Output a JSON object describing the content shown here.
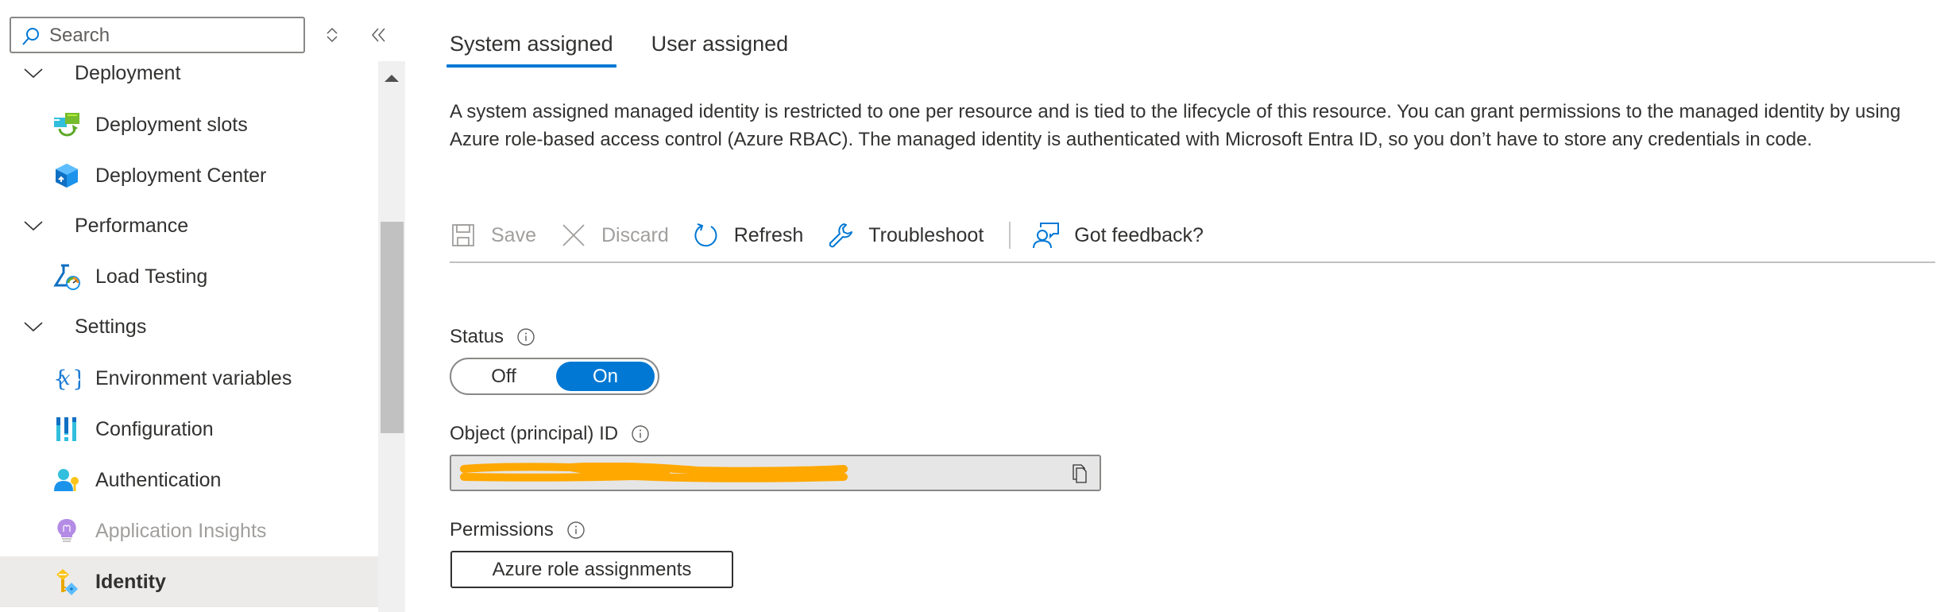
{
  "sidebar": {
    "search_placeholder": "Search",
    "search_value": "",
    "sort_icon": "up-down-icon",
    "collapse_icon": "double-chevron-left-icon",
    "items": [
      {
        "type": "group",
        "label": "Deployment",
        "expanded": true
      },
      {
        "type": "item",
        "label": "Deployment slots",
        "icon": "deployment-slots-icon"
      },
      {
        "type": "item",
        "label": "Deployment Center",
        "icon": "deployment-center-icon"
      },
      {
        "type": "group",
        "label": "Performance",
        "expanded": true
      },
      {
        "type": "item",
        "label": "Load Testing",
        "icon": "load-testing-icon"
      },
      {
        "type": "group",
        "label": "Settings",
        "expanded": true
      },
      {
        "type": "item",
        "label": "Environment variables",
        "icon": "environment-variables-icon"
      },
      {
        "type": "item",
        "label": "Configuration",
        "icon": "configuration-icon"
      },
      {
        "type": "item",
        "label": "Authentication",
        "icon": "authentication-icon"
      },
      {
        "type": "item",
        "label": "Application Insights",
        "icon": "application-insights-icon",
        "disabled": true
      },
      {
        "type": "item",
        "label": "Identity",
        "icon": "identity-icon",
        "selected": true
      }
    ]
  },
  "main": {
    "tabs": [
      {
        "label": "System assigned",
        "active": true
      },
      {
        "label": "User assigned",
        "active": false
      }
    ],
    "description": "A system assigned managed identity is restricted to one per resource and is tied to the lifecycle of this resource. You can grant permissions to the managed identity by using Azure role-based access control (Azure RBAC). The managed identity is authenticated with Microsoft Entra ID, so you don’t have to store any credentials in code.",
    "toolbar": {
      "save": "Save",
      "discard": "Discard",
      "refresh": "Refresh",
      "troubleshoot": "Troubleshoot",
      "feedback": "Got feedback?"
    },
    "status": {
      "label": "Status",
      "off_label": "Off",
      "on_label": "On",
      "value": "On"
    },
    "object_id": {
      "label": "Object (principal) ID",
      "value_redacted": true
    },
    "permissions": {
      "label": "Permissions",
      "button": "Azure role assignments"
    }
  },
  "colors": {
    "accent": "#0078d4",
    "selected_row": "#edebe9",
    "redaction": "#ffa800",
    "disabled_text": "#a19f9d"
  }
}
